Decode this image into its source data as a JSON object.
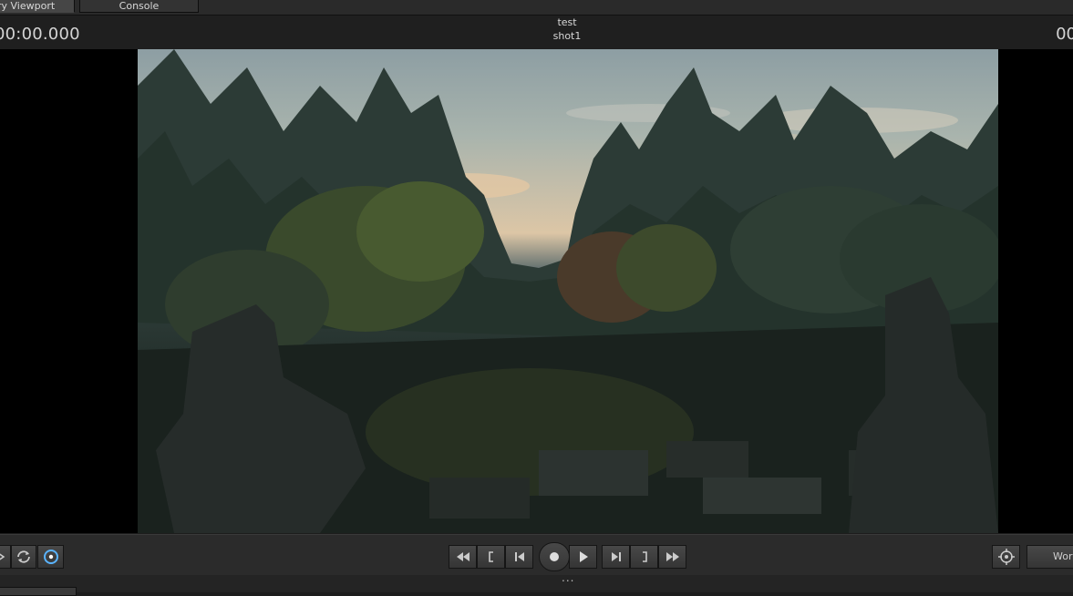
{
  "tabs": [
    {
      "label": "ry Viewport",
      "active": true
    },
    {
      "label": "Console",
      "active": false
    }
  ],
  "header": {
    "time_left": "00:00.000",
    "time_right": "00",
    "scene": "test",
    "shot": "shot1"
  },
  "transport": {
    "left_icons": [
      "arrow-icon",
      "loop-icon",
      "target-toggle-icon"
    ],
    "center_icons": [
      "rewind-icon",
      "mark-in-icon",
      "prev-frame-icon",
      "record-icon",
      "play-icon",
      "next-frame-icon",
      "mark-out-icon",
      "fast-forward-icon"
    ],
    "right_icons": [
      "crosshair-icon"
    ],
    "coord_button": "Worl"
  },
  "footer": {
    "grip": "..."
  }
}
